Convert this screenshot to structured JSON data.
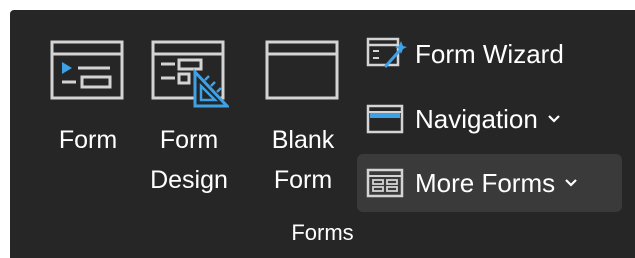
{
  "ribbon": {
    "group_label": "Forms",
    "big_buttons": [
      {
        "label": "Form",
        "icon": "form-icon"
      },
      {
        "label": "Form\nDesign",
        "icon": "form-design-icon"
      },
      {
        "label": "Blank\nForm",
        "icon": "blank-form-icon"
      }
    ],
    "small_buttons": [
      {
        "label": "Form Wizard",
        "icon": "form-wizard-icon"
      },
      {
        "label": "Navigation",
        "icon": "navigation-icon",
        "dropdown": true
      },
      {
        "label": "More Forms",
        "icon": "more-forms-icon",
        "dropdown": true
      }
    ]
  },
  "colors": {
    "background": "#262626",
    "icon_stroke": "#d4d4d4",
    "accent": "#3ea1e6",
    "highlight": "#3a3a3a"
  }
}
